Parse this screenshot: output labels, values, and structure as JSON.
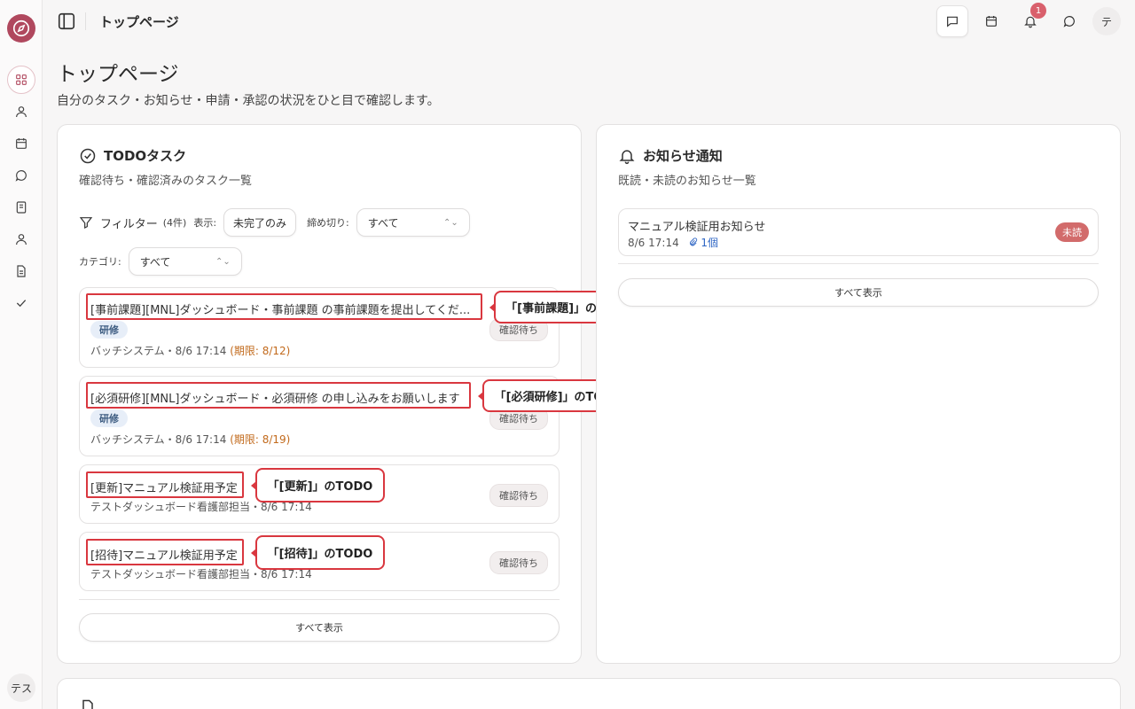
{
  "sidebar": {
    "user_initials": "テス"
  },
  "header": {
    "title": "トップページ",
    "notification_count": "1",
    "avatar_initial": "テ"
  },
  "page": {
    "title": "トップページ",
    "subtitle": "自分のタスク・お知らせ・申請・承認の状況をひと目で確認します。"
  },
  "todo": {
    "title": "TODOタスク",
    "description": "確認待ち・確認済みのタスク一覧",
    "filter_label": "フィルター",
    "filter_count": "(4件)",
    "display_label": "表示:",
    "display_value": "未完了のみ",
    "deadline_label": "締め切り:",
    "deadline_value": "すべて",
    "category_label": "カテゴリ:",
    "category_value": "すべて",
    "items": [
      {
        "title": "[事前課題][MNL]ダッシュボード・事前課題 の事前課題を提出してくだ...",
        "tag": "研修",
        "meta": "バッチシステム・8/6 17:14",
        "due": "(期限: 8/12)",
        "status": "確認待ち",
        "callout": "「[事前課題]」のTODO"
      },
      {
        "title": "[必須研修][MNL]ダッシュボード・必須研修 の申し込みをお願いします",
        "tag": "研修",
        "meta": "バッチシステム・8/6 17:14",
        "due": "(期限: 8/19)",
        "status": "確認待ち",
        "callout": "「[必須研修]」のTODO"
      },
      {
        "title": "[更新]マニュアル検証用予定",
        "meta": "テストダッシュボード看護部担当・8/6 17:14",
        "status": "確認待ち",
        "callout": "「[更新]」のTODO"
      },
      {
        "title": "[招待]マニュアル検証用予定",
        "meta": "テストダッシュボード看護部担当・8/6 17:14",
        "status": "確認待ち",
        "callout": "「[招待]」のTODO"
      }
    ],
    "show_all": "すべて表示"
  },
  "notices": {
    "title": "お知らせ通知",
    "description": "既読・未読のお知らせ一覧",
    "items": [
      {
        "title": "マニュアル検証用お知らせ",
        "date": "8/6 17:14",
        "attachments": "1個",
        "status": "未読"
      }
    ],
    "show_all": "すべて表示"
  },
  "colors": {
    "accent": "#b0485e",
    "highlight": "#d9373f",
    "unread": "#d26b6b",
    "due": "#c26a1c"
  }
}
